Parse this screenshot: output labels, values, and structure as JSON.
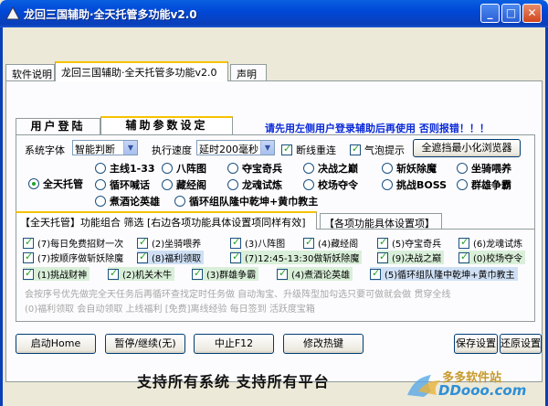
{
  "window": {
    "title": "龙回三国辅助·全天托管多功能v2.0",
    "minimize": "_",
    "maximize": "□",
    "close": "✕"
  },
  "outer_tabs": [
    "软件说明",
    "龙回三国辅助·全天托管多功能v2.0",
    "声明"
  ],
  "inner_tabs": [
    "用户登陆",
    "辅助参数设定"
  ],
  "notice": "请先用左侧用户登录辅助后再使用 否则报错！！！",
  "settings": {
    "font_label": "系统字体",
    "font_value": "智能判断",
    "speed_label": "执行速度",
    "speed_value": "延时200毫秒",
    "reconnect_label": "断线重连",
    "reconnect_checked": true,
    "bubble_label": "气泡提示",
    "bubble_checked": true,
    "hide_browser_btn": "全遮挡最小化浏览器"
  },
  "modes": {
    "all_day": {
      "label": "全天托管",
      "selected": true
    },
    "row1": [
      "主线1-33",
      "八阵图",
      "夺宝奇兵",
      "决战之巅",
      "斩妖除魔",
      "坐骑喂养"
    ],
    "row2": [
      "循环喊话",
      "藏经阁",
      "龙魂试炼",
      "校场夺令",
      "挑战BOSS",
      "群雄争霸"
    ],
    "row3": [
      "煮酒论英雄",
      "循环组队隆中乾坤+黄巾教主"
    ]
  },
  "group_tabs": [
    "【全天托管】功能组合 筛选 [右边各项功能具体设置项同样有效]",
    "【各项功能具体设置项】"
  ],
  "features": [
    {
      "label": "(7)每日免费招财一次",
      "checked": true,
      "color": "#ffffff"
    },
    {
      "label": "(2)坐骑喂养",
      "checked": true,
      "color": "#ffffff"
    },
    {
      "label": "(3)八阵图",
      "checked": true,
      "color": "#ffffff"
    },
    {
      "label": "(4)藏经阁",
      "checked": true,
      "color": "#ffffff"
    },
    {
      "label": "(5)夺宝奇兵",
      "checked": true,
      "color": "#ffffff"
    },
    {
      "label": "(6)龙魂试炼",
      "checked": true,
      "color": "#ffffff"
    },
    {
      "label": "(7)按顺序做斩妖除魔",
      "checked": true,
      "color": "#ffffff"
    },
    {
      "label": "(8)福利领取",
      "checked": true,
      "color": "#cfe0f5"
    },
    {
      "label": "(7)12:45-13:30做斩妖除魔",
      "checked": true,
      "color": "#d9efd9"
    },
    {
      "label": "(9)决战之巅",
      "checked": true,
      "color": "#d9efd9"
    },
    {
      "label": "(0)校场夺令",
      "checked": true,
      "color": "#d9efd9"
    },
    {
      "label": "(1)挑战财神",
      "checked": true,
      "color": "#d9efd9"
    },
    {
      "label": "(2)机关木牛",
      "checked": true,
      "color": "#d9efd9"
    },
    {
      "label": "(3)群雄争霸",
      "checked": true,
      "color": "#d9efd9"
    },
    {
      "label": "(4)煮酒论英雄",
      "checked": true,
      "color": "#d9efd9"
    },
    {
      "label": "(5)循环组队隆中乾坤+黄巾教主",
      "checked": true,
      "color": "#cfe0f5"
    }
  ],
  "hints": [
    "会按序号优先做完全天任务后再循环查找定时任务做   自动淘宝、升级阵型加勾选只要可做就会做  贯穿全线",
    "(0)福利领取  会自动领取  上线福利  [免费]离线经验  每日签到  活跃度宝箱"
  ],
  "buttons": {
    "start": "启动Home",
    "pause": "暂停/继续(无)",
    "stop": "中止F12",
    "hotkey": "修改热键",
    "save": "保存设置",
    "restore": "还原设置"
  },
  "footer": "支持所有系统  支持所有平台",
  "watermark": {
    "name": "多多软件站",
    "url": "DDooo.com"
  }
}
